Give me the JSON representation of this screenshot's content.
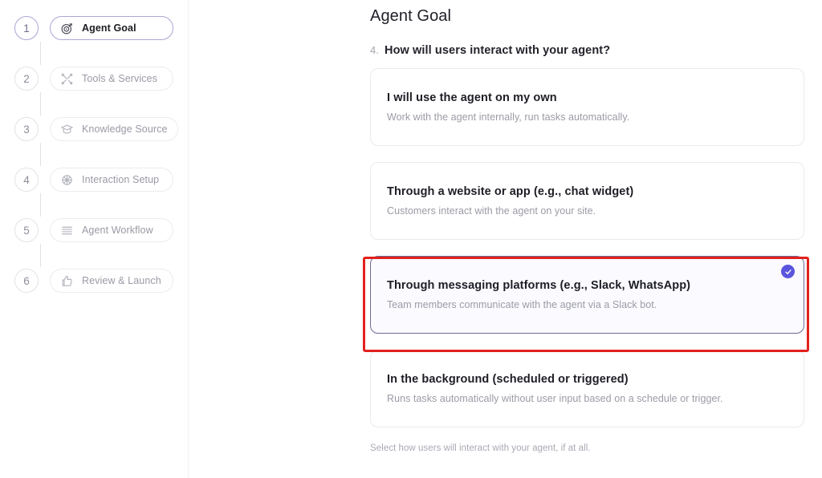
{
  "sidebar": {
    "steps": [
      {
        "number": "1",
        "label": "Agent Goal",
        "icon": "target-icon",
        "active": true
      },
      {
        "number": "2",
        "label": "Tools & Services",
        "icon": "tools-icon",
        "active": false
      },
      {
        "number": "3",
        "label": "Knowledge Source",
        "icon": "graduation-cap-icon",
        "active": false
      },
      {
        "number": "4",
        "label": "Interaction Setup",
        "icon": "gear-icon",
        "active": false
      },
      {
        "number": "5",
        "label": "Agent Workflow",
        "icon": "list-lines-icon",
        "active": false
      },
      {
        "number": "6",
        "label": "Review & Launch",
        "icon": "thumbs-up-icon",
        "active": false
      }
    ]
  },
  "main": {
    "title": "Agent Goal",
    "question_number": "4.",
    "question": "How will users interact with your agent?",
    "options": [
      {
        "title": "I will use the agent on my own",
        "desc": "Work with the agent internally, run tasks automatically.",
        "selected": false
      },
      {
        "title": "Through a website or app (e.g., chat widget)",
        "desc": "Customers interact with the agent on your site.",
        "selected": false
      },
      {
        "title": "Through messaging platforms (e.g., Slack, WhatsApp)",
        "desc": "Team members communicate with the agent via a Slack bot.",
        "selected": true
      },
      {
        "title": "In the background (scheduled or triggered)",
        "desc": "Runs tasks automatically without user input based on a schedule or trigger.",
        "selected": false
      }
    ],
    "helper_note": "Select how users will interact with your agent, if at all."
  },
  "colors": {
    "accent_purple": "#5b55dd",
    "active_step_border": "#a9a6d4",
    "selected_card_border": "#6e6c93",
    "selected_card_bg": "#fafaff",
    "highlight_red": "#e2211c",
    "muted_text": "#9b9ba6"
  }
}
